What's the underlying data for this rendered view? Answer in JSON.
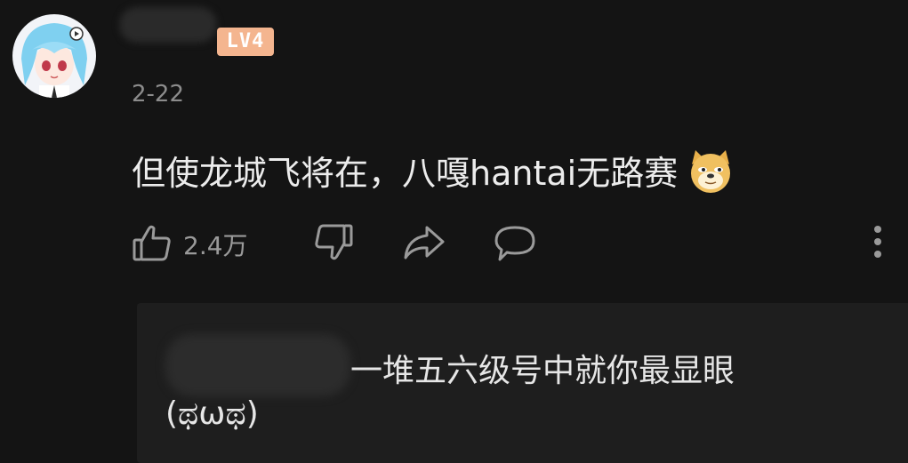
{
  "comment": {
    "level_badge": "LV4",
    "date": "2-22",
    "text": "但使龙城飞将在，八嘎hantai无路赛",
    "emoji": "doge-emoji"
  },
  "actions": {
    "like_count": "2.4万",
    "icons": [
      "thumbs-up-icon",
      "thumbs-down-icon",
      "share-icon",
      "comment-icon",
      "more-vertical-icon"
    ]
  },
  "reply": {
    "text_line1": "一堆五六级号中就你最显眼",
    "text_line2": "(ಥωಥ)"
  },
  "colors": {
    "background": "#141414",
    "reply_background": "#1e1e1e",
    "level_badge": "#f4b58f",
    "muted_text": "#8c8c8c"
  }
}
